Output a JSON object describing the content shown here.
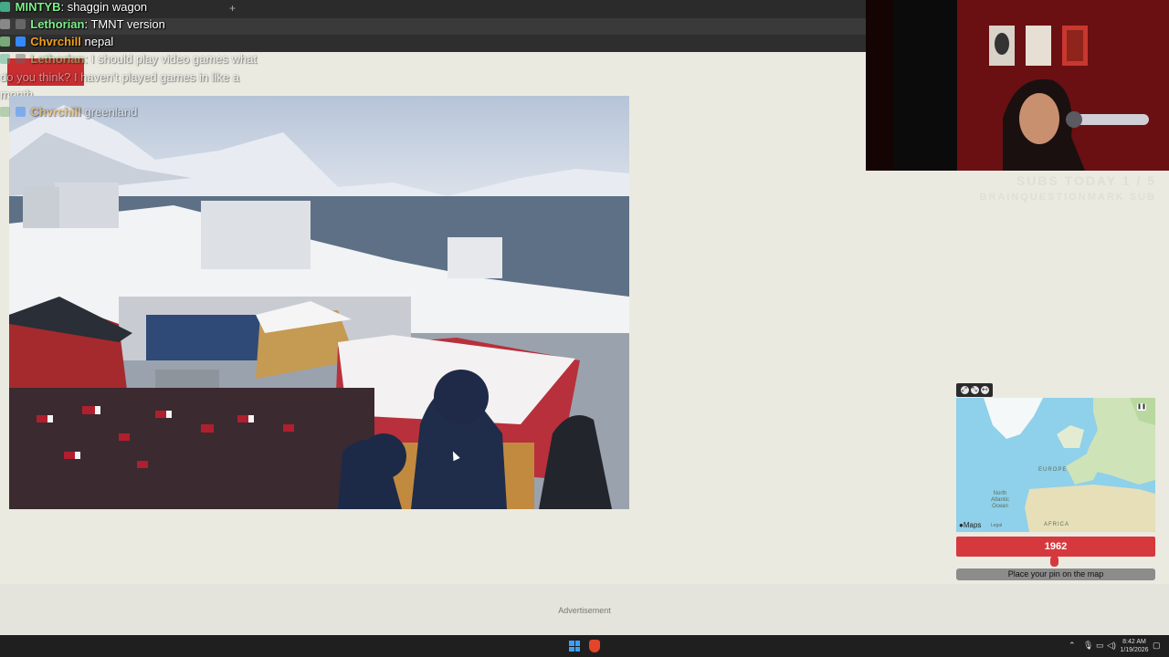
{
  "chat": [
    {
      "user": "MINTYB",
      "text": "shaggin wagon",
      "color": "#7df08a"
    },
    {
      "user": "Lethorian",
      "text": "TMNT version",
      "color": "#7df08a"
    },
    {
      "user": "Chvrchill",
      "text": "nepal",
      "color": "#f0a020"
    },
    {
      "user": "Lethorian",
      "text": "I should play video games what do you think? I haven't played games in like a month.",
      "color": "#7df08a",
      "line1": "I should play video games what",
      "line2": "do you think? I haven't played games in like a",
      "line3": "month."
    },
    {
      "user": "Chvrchill",
      "text": "greenland",
      "color": "#f0a020"
    }
  ],
  "overlay": {
    "subs_today": "SUBS TODAY 1 / 5",
    "subs_sub": "BRAINQUESTIONMARK SUB"
  },
  "map": {
    "labels": {
      "europe": "EUROPE",
      "africa": "AFRICA",
      "ocean": "North Atlantic Ocean"
    },
    "maps_logo": "Maps",
    "legal": "Legal"
  },
  "game": {
    "year": "1962",
    "year_fraction": 0.49,
    "pin_button": "Place your pin on the map"
  },
  "advert": {
    "label": "Advertisement"
  },
  "taskbar": {
    "time": "8:42 AM",
    "date": "1/19/2026"
  },
  "colors": {
    "accent": "#d6393d",
    "background": "#ebeae0"
  }
}
